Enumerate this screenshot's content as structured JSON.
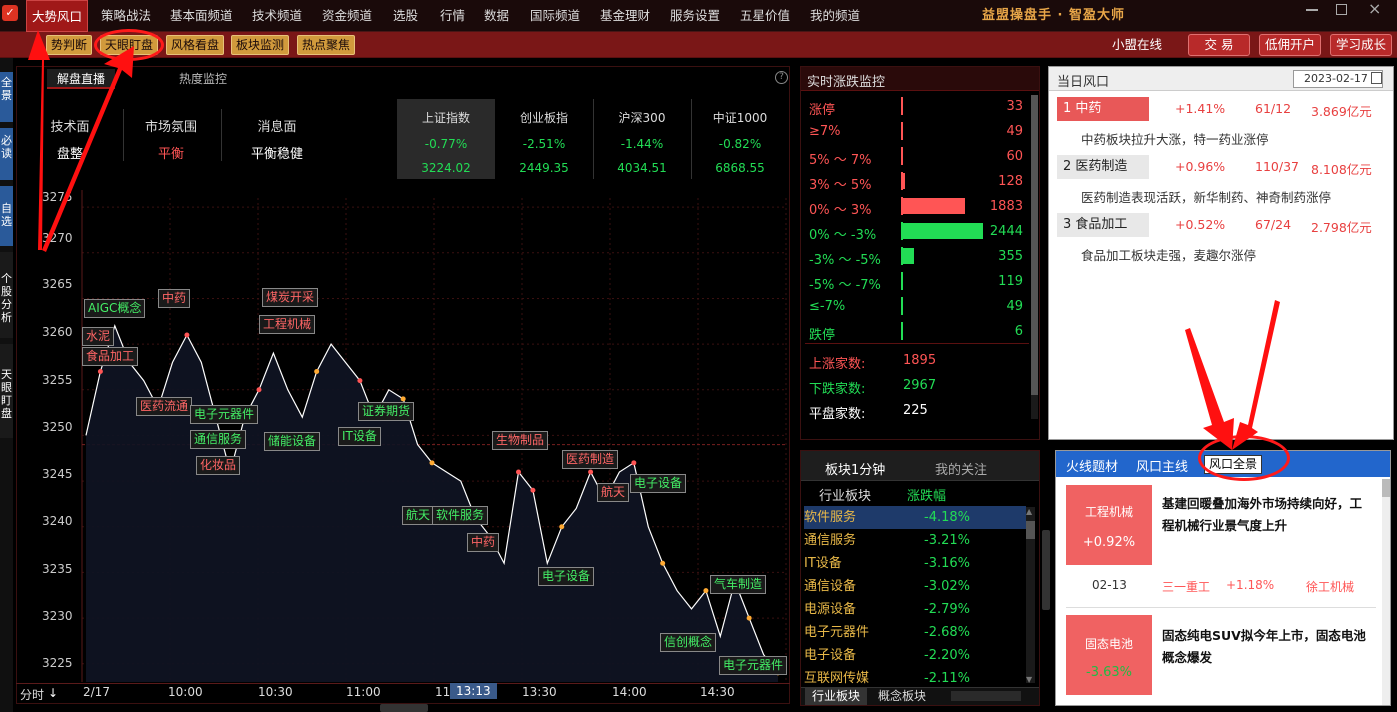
{
  "menu": [
    "大势风口",
    "策略战法",
    "基本面频道",
    "技术频道",
    "资金频道",
    "选股",
    "行情",
    "数据",
    "国际频道",
    "基金理财",
    "服务设置",
    "五星价值",
    "我的频道"
  ],
  "brand": "益盟操盘手 · 智盈大师",
  "subbar": {
    "buttons": [
      "势判断",
      "天眼盯盘",
      "风格看盘",
      "板块监测",
      "热点聚焦"
    ],
    "online": "小盟在线",
    "right_buttons": [
      "交 易",
      "低佣开户",
      "学习成长"
    ]
  },
  "sidebar_tabs": [
    "全景",
    "必读",
    "自选",
    "个股分析",
    "天眼盯盘"
  ],
  "left_panel": {
    "tabs": [
      "解盘直播",
      "热度监控"
    ],
    "summary": {
      "labels": [
        "技术面",
        "市场氛围",
        "消息面"
      ],
      "values": [
        "盘整",
        "平衡",
        "平衡稳健"
      ]
    },
    "indices": [
      {
        "name": "上证指数",
        "pct": "-0.77%",
        "val": "3224.02"
      },
      {
        "name": "创业板指",
        "pct": "-2.51%",
        "val": "2449.35"
      },
      {
        "name": "沪深300",
        "pct": "-1.44%",
        "val": "4034.51"
      },
      {
        "name": "中证1000",
        "pct": "-0.82%",
        "val": "6868.55"
      }
    ],
    "y_ticks": [
      "3275",
      "3270",
      "3265",
      "3260",
      "3255",
      "3250",
      "3245",
      "3240",
      "3235",
      "3230",
      "3225"
    ],
    "x_ticks": [
      "2/17",
      "10:00",
      "10:30",
      "11:00",
      "11",
      "13:13",
      "13:30",
      "14:00",
      "14:30"
    ],
    "x_left_label": "分时",
    "annotations": [
      "AIGC概念",
      "水泥",
      "食品加工",
      "中药",
      "医药流通",
      "电子元器件",
      "通信服务",
      "化妆品",
      "煤炭开采",
      "工程机械",
      "储能设备",
      "证券期货",
      "IT设备",
      "生物制品",
      "航天",
      "软件服务",
      "中药",
      "医药制造",
      "航天",
      "电子设备",
      "电子设备",
      "气车制造",
      "信创概念",
      "电子元器件"
    ]
  },
  "chart_data": {
    "type": "line",
    "x_ticks": [
      "2/17",
      "10:00",
      "10:30",
      "11:00",
      "11",
      "13:13",
      "13:30",
      "14:00",
      "14:30"
    ],
    "ylim": [
      3223,
      3276
    ],
    "y_ticks": [
      3275,
      3270,
      3265,
      3260,
      3255,
      3250,
      3245,
      3240,
      3235,
      3230,
      3225
    ],
    "reference_line": 3249,
    "series": [
      {
        "values": [
          3250,
          3257,
          3262,
          3258,
          3256,
          3253,
          3258,
          3261,
          3258,
          3252,
          3246,
          3252,
          3255,
          3259,
          3255,
          3252,
          3257,
          3260,
          3258,
          3256,
          3252,
          3255,
          3254,
          3249,
          3247,
          3246,
          3245,
          3241,
          3239,
          3236,
          3246,
          3244,
          3236,
          3240,
          3242,
          3246,
          3243,
          3246,
          3247,
          3240,
          3236,
          3233,
          3231,
          3233,
          3228,
          3234,
          3230,
          3226,
          3224
        ]
      }
    ]
  },
  "rz_panel": {
    "title": "实时涨跌监控",
    "rows": [
      {
        "label": "涨停",
        "count": "33",
        "color": "#ff5555",
        "bar": 0.0
      },
      {
        "label": "≥7%",
        "count": "49",
        "color": "#ff5555",
        "bar": 0.0
      },
      {
        "label": "5% ～ 7%",
        "count": "60",
        "color": "#ff5555",
        "bar": 0.0
      },
      {
        "label": "3% ～ 5%",
        "count": "128",
        "color": "#ff5555",
        "bar": 0.02
      },
      {
        "label": "0% ～ 3%",
        "count": "1883",
        "color": "#ff5555",
        "bar": 0.77
      },
      {
        "label": "0% ～ -3%",
        "count": "2444",
        "color": "#22dd55",
        "bar": 1.0
      },
      {
        "label": "-3% ～ -5%",
        "count": "355",
        "color": "#22dd55",
        "bar": 0.14
      },
      {
        "label": "-5% ～ -7%",
        "count": "119",
        "color": "#22dd55",
        "bar": 0.0
      },
      {
        "label": "≤-7%",
        "count": "49",
        "color": "#22dd55",
        "bar": 0.0
      },
      {
        "label": "跌停",
        "count": "6",
        "color": "#22dd55",
        "bar": 0.0
      }
    ],
    "totals": [
      {
        "label": "上涨家数:",
        "val": "1895",
        "color": "#ff5555"
      },
      {
        "label": "下跌家数:",
        "val": "2967",
        "color": "#22dd55"
      },
      {
        "label": "平盘家数:",
        "val": "225",
        "color": "#ffffff"
      }
    ]
  },
  "day_risk": {
    "title": "当日风口",
    "date": "2023-02-17",
    "items": [
      {
        "rank": "1 中药",
        "pct": "+1.41%",
        "ratio": "61/12",
        "amt": "3.869亿元",
        "desc": "中药板块拉升大涨，特一药业涨停",
        "hl": true
      },
      {
        "rank": "2 医药制造",
        "pct": "+0.96%",
        "ratio": "110/37",
        "amt": "8.108亿元",
        "desc": "医药制造表现活跃，新华制药、神奇制药涨停",
        "hl": false
      },
      {
        "rank": "3 食品加工",
        "pct": "+0.52%",
        "ratio": "67/24",
        "amt": "2.798亿元",
        "desc": "食品加工板块走强，麦趣尔涨停",
        "hl": false
      }
    ]
  },
  "hot_panel": {
    "tabs": [
      "火线题材",
      "风口主线",
      "风口全景"
    ],
    "cards": [
      {
        "name": "工程机械",
        "pct": "+0.92%",
        "headline": "基建回暖叠加海外市场持续向好，工程机械行业景气度上升",
        "date": "02-13",
        "stock": "三一重工",
        "stock_pct": "+1.18%",
        "tag": "徐工机械"
      },
      {
        "name": "固态电池",
        "pct": "-3.63%",
        "headline": "固态纯电SUV拟今年上市，固态电池概念爆发"
      }
    ]
  },
  "sector_panel": {
    "tabs": [
      "板块1分钟",
      "我的关注"
    ],
    "cols": [
      "行业板块",
      "涨跌幅"
    ],
    "rows": [
      {
        "name": "软件服务",
        "pct": "-4.18%"
      },
      {
        "name": "通信服务",
        "pct": "-3.21%"
      },
      {
        "name": "IT设备",
        "pct": "-3.16%"
      },
      {
        "name": "通信设备",
        "pct": "-3.02%"
      },
      {
        "name": "电源设备",
        "pct": "-2.79%"
      },
      {
        "name": "电子元器件",
        "pct": "-2.68%"
      },
      {
        "name": "电子设备",
        "pct": "-2.20%"
      },
      {
        "name": "互联网传媒",
        "pct": "-2.11%"
      }
    ],
    "bottom_tabs": [
      "行业板块",
      "概念板块"
    ]
  },
  "colors": {
    "accent": "#a01818",
    "up": "#ff5555",
    "down": "#22dd55",
    "gold": "#e8b848",
    "card": "#f06262"
  }
}
